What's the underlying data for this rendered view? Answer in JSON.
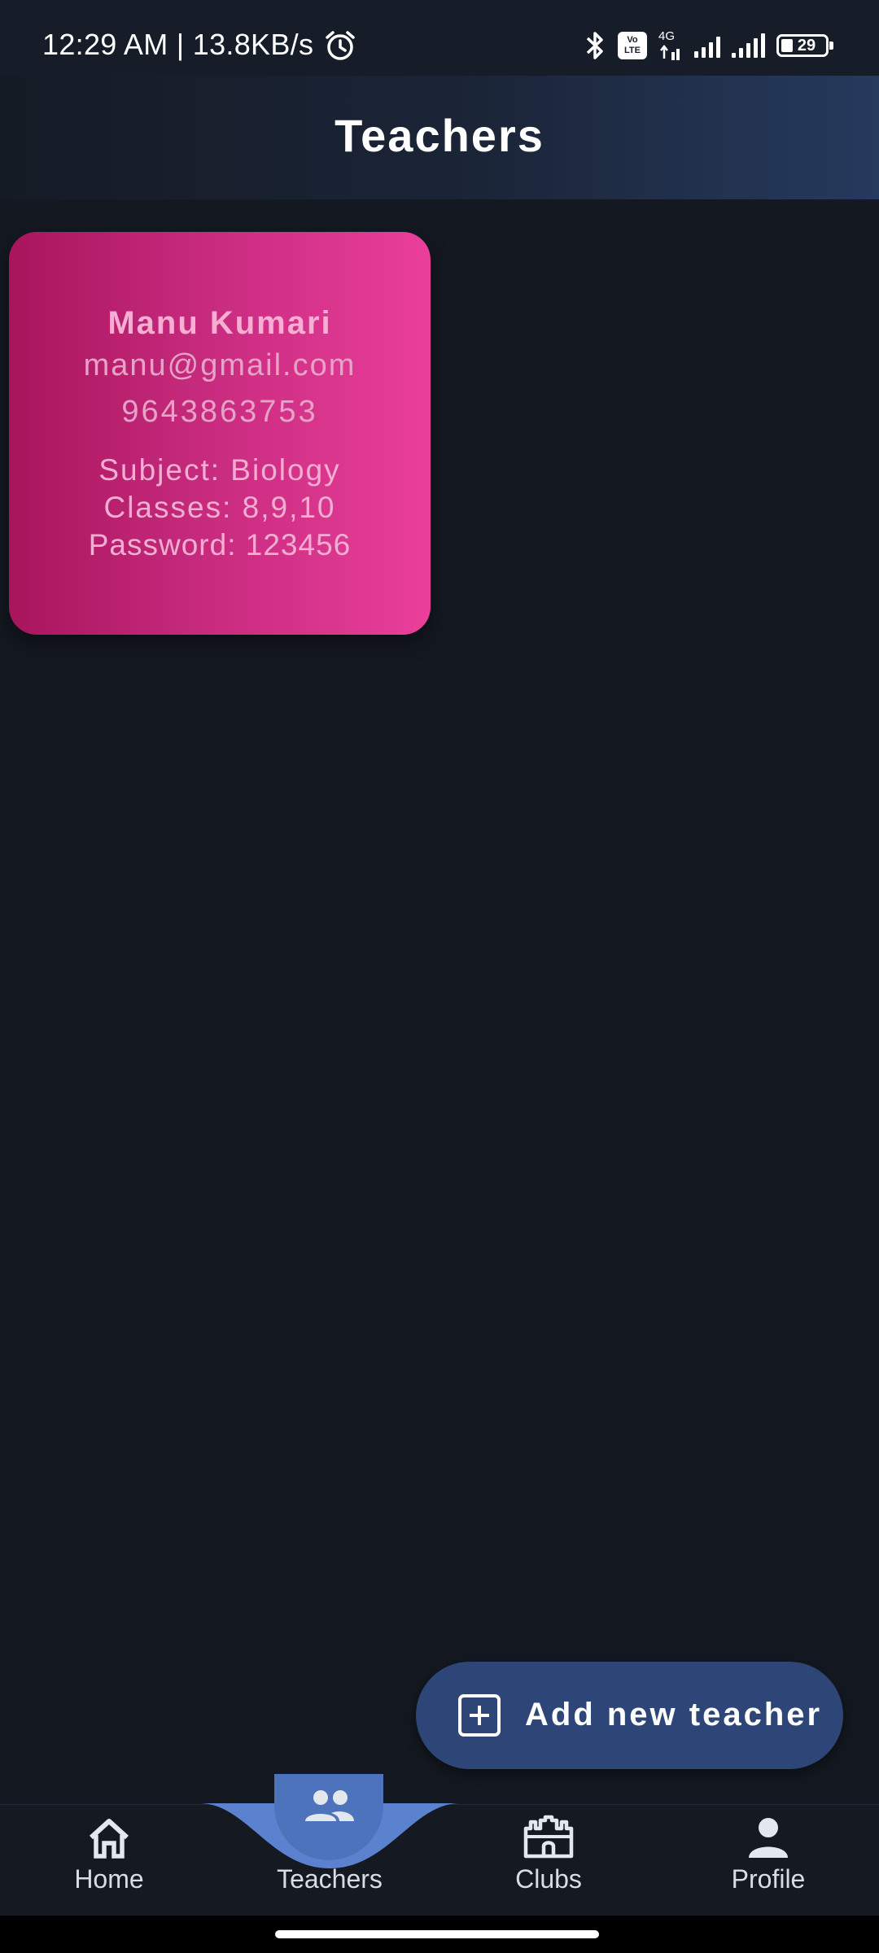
{
  "status_bar": {
    "time": "12:29 AM | 13.8KB/s",
    "network_type": "4G",
    "volte": "Vo LTE",
    "battery": "29"
  },
  "app_bar": {
    "title": "Teachers"
  },
  "teachers": [
    {
      "name": "Manu Kumari",
      "email": "manu@gmail.com",
      "phone": "9643863753",
      "subject": "Subject: Biology",
      "classes": "Classes: 8,9,10",
      "password": "Password: 123456"
    }
  ],
  "fab": {
    "label": "Add new teacher",
    "icon": "add-box-icon"
  },
  "bottom_nav": {
    "items": [
      {
        "label": "Home",
        "icon": "home-icon"
      },
      {
        "label": "Teachers",
        "icon": "people-icon"
      },
      {
        "label": "Clubs",
        "icon": "castle-icon"
      },
      {
        "label": "Profile",
        "icon": "person-icon"
      }
    ],
    "selected": "Teachers"
  },
  "colors": {
    "background": "#141820",
    "card_gradient_start": "#a8155c",
    "card_gradient_end": "#ea3f9b",
    "fab": "#2d4677",
    "nav_active": "#4d73bd"
  }
}
